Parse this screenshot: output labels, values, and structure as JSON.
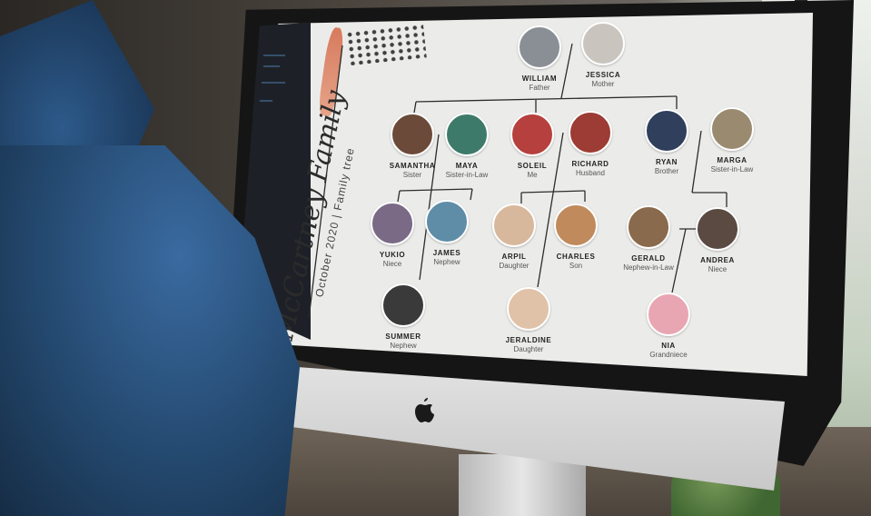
{
  "tree": {
    "title": "McCartney Family",
    "subtitle": "October 2020 | Family tree",
    "people": [
      {
        "key": "william",
        "name": "WILLIAM",
        "role": "Father",
        "color": "#8a8f96"
      },
      {
        "key": "jessica",
        "name": "JESSICA",
        "role": "Mother",
        "color": "#c9c4be"
      },
      {
        "key": "samantha",
        "name": "SAMANTHA",
        "role": "Sister",
        "color": "#6b4a3a"
      },
      {
        "key": "maya",
        "name": "MAYA",
        "role": "Sister-in-Law",
        "color": "#3d7a6a"
      },
      {
        "key": "soleil",
        "name": "SOLEIL",
        "role": "Me",
        "color": "#b6403d"
      },
      {
        "key": "richard",
        "name": "RICHARD",
        "role": "Husband",
        "color": "#9c3c34"
      },
      {
        "key": "ryan",
        "name": "RYAN",
        "role": "Brother",
        "color": "#2f3f5c"
      },
      {
        "key": "marga",
        "name": "MARGA",
        "role": "Sister-in-Law",
        "color": "#9a8a70"
      },
      {
        "key": "yukio",
        "name": "YUKIO",
        "role": "Niece",
        "color": "#7a6a86"
      },
      {
        "key": "james",
        "name": "JAMES",
        "role": "Nephew",
        "color": "#5f8da8"
      },
      {
        "key": "arpil",
        "name": "ARPIL",
        "role": "Daughter",
        "color": "#d8b89c"
      },
      {
        "key": "charles",
        "name": "CHARLES",
        "role": "Son",
        "color": "#c08a5c"
      },
      {
        "key": "gerald",
        "name": "GERALD",
        "role": "Nephew-in-Law",
        "color": "#8a6a4c"
      },
      {
        "key": "andrea",
        "name": "ANDREA",
        "role": "Niece",
        "color": "#5a4a42"
      },
      {
        "key": "summer",
        "name": "SUMMER",
        "role": "Nephew",
        "color": "#3a3a3a"
      },
      {
        "key": "jeraldine",
        "name": "JERALDINE",
        "role": "Daughter",
        "color": "#e0c2a8"
      },
      {
        "key": "nia",
        "name": "NIA",
        "role": "Grandniece",
        "color": "#e8a6b2"
      }
    ]
  },
  "icons": {
    "apple_logo": "apple-logo-icon"
  }
}
